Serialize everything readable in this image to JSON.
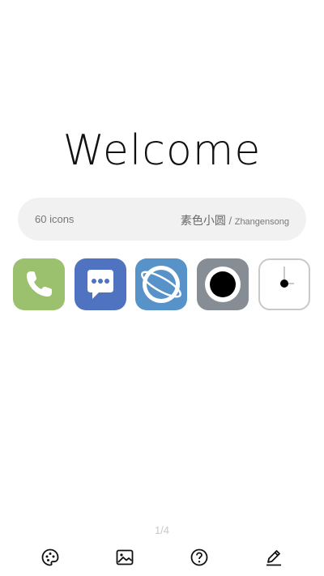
{
  "welcome": {
    "title": "Welcome"
  },
  "info": {
    "icon_count": "60 icons",
    "theme_name": "素色小圆",
    "separator": "/",
    "author": "Zhangensong"
  },
  "icons": [
    {
      "name": "phone-icon",
      "color": "#9bc06e"
    },
    {
      "name": "messages-icon",
      "color": "#4f73c1"
    },
    {
      "name": "browser-icon",
      "color": "#5792c9"
    },
    {
      "name": "camera-icon",
      "color": "#868d95"
    },
    {
      "name": "clock-icon",
      "color": "#ffffff"
    }
  ],
  "pager": {
    "label": "1/4"
  },
  "nav": [
    {
      "name": "palette-icon"
    },
    {
      "name": "wallpaper-icon"
    },
    {
      "name": "help-icon"
    },
    {
      "name": "edit-icon"
    }
  ]
}
